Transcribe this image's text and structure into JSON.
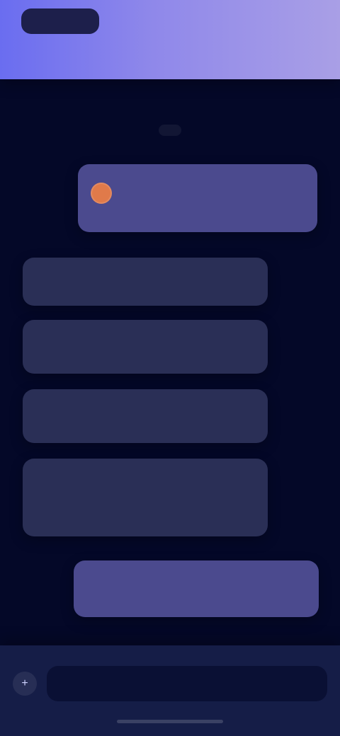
{
  "header": {
    "app_name": "",
    "subtitle": "",
    "actions": [
      "",
      ""
    ]
  },
  "chat": {
    "date_label": "",
    "messages": [
      {
        "direction": "out",
        "text": "",
        "meta": ""
      },
      {
        "direction": "in",
        "text": ""
      },
      {
        "direction": "in",
        "text": ""
      },
      {
        "direction": "in",
        "text": ""
      },
      {
        "direction": "in",
        "text": ""
      },
      {
        "direction": "out",
        "text": ""
      }
    ]
  },
  "composer": {
    "placeholder": "",
    "left_icon": "plus-icon"
  },
  "colors": {
    "header_gradient_start": "#6a6df0",
    "header_gradient_end": "#a99fe6",
    "background": "#040828",
    "bubble_outgoing": "#4b4a8e",
    "bubble_incoming": "#2a2f56",
    "avatar": "#e07a4a"
  }
}
